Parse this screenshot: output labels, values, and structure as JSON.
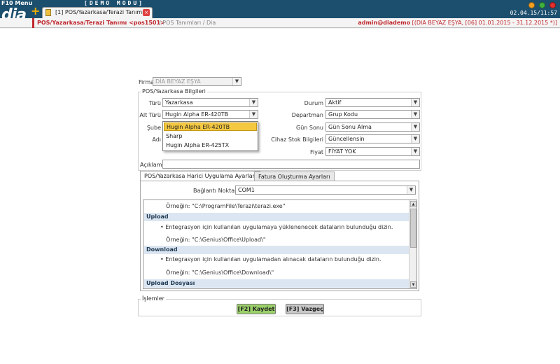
{
  "topbar": {
    "f10": "F10 Menu",
    "logo": "dia",
    "logo_plus": "+",
    "demo": "[DEMO MODU]",
    "tab_label": "[1] POS/Yazarkasa/Terazi Tanımı",
    "tab_close": "×",
    "clock": "02.04.15/11:57"
  },
  "breadcrumb": {
    "main": "POS/Yazarkasa/Terazi Tanımı <pos1501>",
    "rest": "/ POS Tanımları / Dia",
    "user": "admin@diademo",
    "context": "[(DIA BEYAZ EŞYA, [06] 01.01.2015 - 31.12.2015 *)]"
  },
  "form": {
    "firma_label": "Firma",
    "firma_value": "DİA BEYAZ EŞYA",
    "section_title": "POS/Yazarkasa Bilgileri",
    "turu_label": "Türü",
    "turu_value": "Yazarkasa",
    "alt_turu_label": "Alt Türü",
    "alt_turu_value": "Hugin Alpha ER-420TB",
    "sube_label": "Şube",
    "adi_label": "Adı",
    "durum_label": "Durum",
    "durum_value": "Aktif",
    "departman_label": "Departman",
    "departman_value": "Grup Kodu",
    "gun_sonu_label": "Gün Sonu",
    "gun_sonu_value": "Gün Sonu Alma",
    "cihaz_stok_label": "Cihaz Stok Bilgileri",
    "cihaz_stok_value": "Güncellensin",
    "fiyat_label": "Fiyat",
    "fiyat_value": "FİYAT YOK",
    "aciklama_label": "Açıklama",
    "dropdown_options": [
      "Hugin Alpha ER-420TB",
      "Sharp",
      "Hugin Alpha ER-425TX"
    ]
  },
  "tabs": {
    "tab1": "POS/Yazarkasa Harici Uygulama Ayarları",
    "tab2": "Fatura Oluşturma Ayarları"
  },
  "panel": {
    "baglanti_label": "Bağlantı Noktası",
    "baglanti_value": "COM1",
    "example_top": "Örneğin: \"C:\\ProgramFile\\Terazi\\terazi.exe\"",
    "upload_head": "Upload",
    "upload_bullet": "• Entegrasyon için kullanılan uygulamaya yüklenenecek dataların bulunduğu dizin.",
    "upload_example": "Örneğin: \"C:\\Genius\\Office\\Upload\\\"",
    "download_head": "Download",
    "download_bullet": "• Entegrasyon için kullanılan uygulamadan alınacak dataların bulunduğu dizin.",
    "download_example": "Örneğin: \"C:\\Genius\\Office\\Download\\\"",
    "upload_dosyasi_head": "Upload Dosyası"
  },
  "actions": {
    "section_title": "İşlemler",
    "save": "[F2] Kaydet",
    "cancel": "[F3] Vazgeç"
  },
  "colors": {
    "topbar": "#1c4f6e",
    "accent_red": "#c0272d",
    "selected": "#f5c842",
    "save_green": "#9bd06a"
  }
}
